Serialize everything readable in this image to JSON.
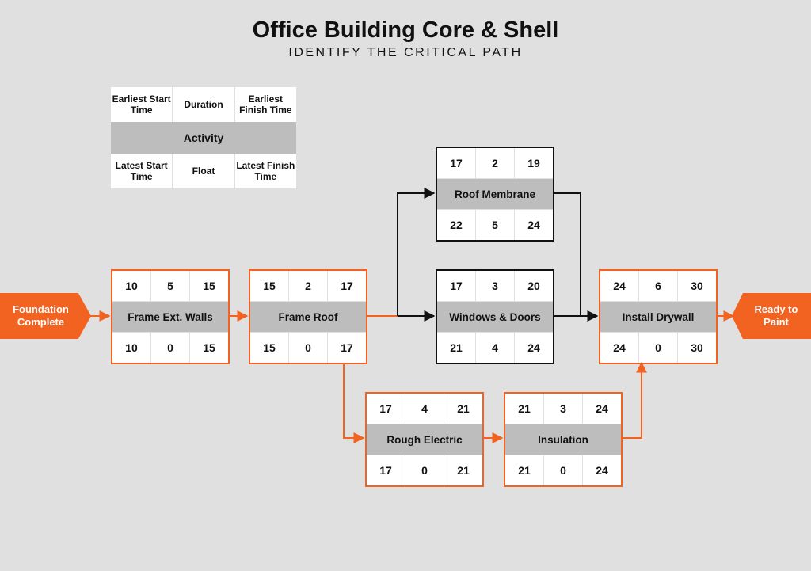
{
  "header": {
    "title": "Office Building Core & Shell",
    "subtitle": "IDENTIFY THE CRITICAL PATH"
  },
  "legend": {
    "top": [
      "Earliest Start Time",
      "Duration",
      "Earliest Finish Time"
    ],
    "middle": "Activity",
    "bottom": [
      "Latest Start Time",
      "Float",
      "Latest Finish Time"
    ]
  },
  "milestones": {
    "start": "Foundation Complete",
    "end": "Ready to Paint"
  },
  "nodes": {
    "frame_walls": {
      "name": "Frame Ext. Walls",
      "es": 10,
      "dur": 5,
      "ef": 15,
      "ls": 10,
      "float": 0,
      "lf": 15
    },
    "frame_roof": {
      "name": "Frame Roof",
      "es": 15,
      "dur": 2,
      "ef": 17,
      "ls": 15,
      "float": 0,
      "lf": 17
    },
    "roof_membrane": {
      "name": "Roof Membrane",
      "es": 17,
      "dur": 2,
      "ef": 19,
      "ls": 22,
      "float": 5,
      "lf": 24
    },
    "windows_doors": {
      "name": "Windows & Doors",
      "es": 17,
      "dur": 3,
      "ef": 20,
      "ls": 21,
      "float": 4,
      "lf": 24
    },
    "rough_electric": {
      "name": "Rough Electric",
      "es": 17,
      "dur": 4,
      "ef": 21,
      "ls": 17,
      "float": 0,
      "lf": 21
    },
    "insulation": {
      "name": "Insulation",
      "es": 21,
      "dur": 3,
      "ef": 24,
      "ls": 21,
      "float": 0,
      "lf": 24
    },
    "install_drywall": {
      "name": "Install Drywall",
      "es": 24,
      "dur": 6,
      "ef": 30,
      "ls": 24,
      "float": 0,
      "lf": 30
    }
  },
  "colors": {
    "critical": "#f26322",
    "normal": "#111111",
    "band": "#bdbdbd",
    "bg": "#e0e0e0"
  }
}
